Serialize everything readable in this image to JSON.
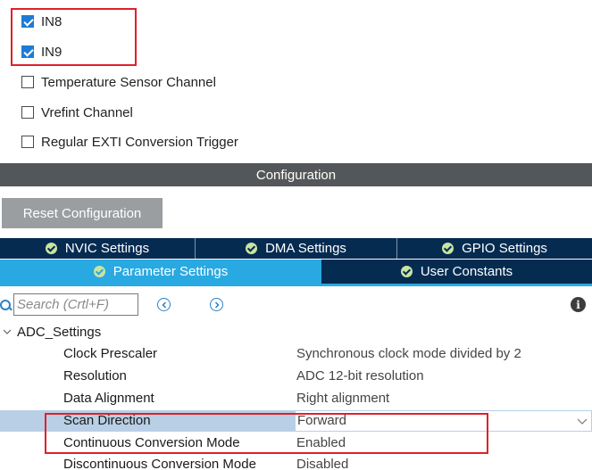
{
  "channels": [
    {
      "label": "IN8",
      "checked": true
    },
    {
      "label": "IN9",
      "checked": true
    },
    {
      "label": "Temperature Sensor Channel",
      "checked": false
    },
    {
      "label": "Vrefint Channel",
      "checked": false
    },
    {
      "label": "Regular EXTI Conversion Trigger",
      "checked": false
    }
  ],
  "configuration": {
    "title": "Configuration"
  },
  "reset_button": "Reset Configuration",
  "tabs_row1": [
    "NVIC Settings",
    "DMA Settings",
    "GPIO Settings"
  ],
  "tabs_row2": [
    "Parameter Settings",
    "User Constants"
  ],
  "active_tab": "Parameter Settings",
  "search": {
    "placeholder": "Search (Crtl+F)",
    "value": ""
  },
  "group": {
    "label": "ADC_Settings",
    "expanded": true
  },
  "params": [
    {
      "name": "Clock Prescaler",
      "value": "Synchronous clock mode divided by 2"
    },
    {
      "name": "Resolution",
      "value": "ADC 12-bit resolution"
    },
    {
      "name": "Data Alignment",
      "value": "Right alignment"
    },
    {
      "name": "Scan Direction",
      "value": "Forward",
      "selected": true
    },
    {
      "name": "Continuous Conversion Mode",
      "value": "Enabled"
    },
    {
      "name": "Discontinuous Conversion Mode",
      "value": "Disabled"
    }
  ],
  "colors": {
    "highlight_box": "#e0202a",
    "config_bar": "#545759",
    "tab_dark": "#052b51",
    "tab_active": "#29a9e1",
    "selected_row": "#b9cfe6"
  }
}
